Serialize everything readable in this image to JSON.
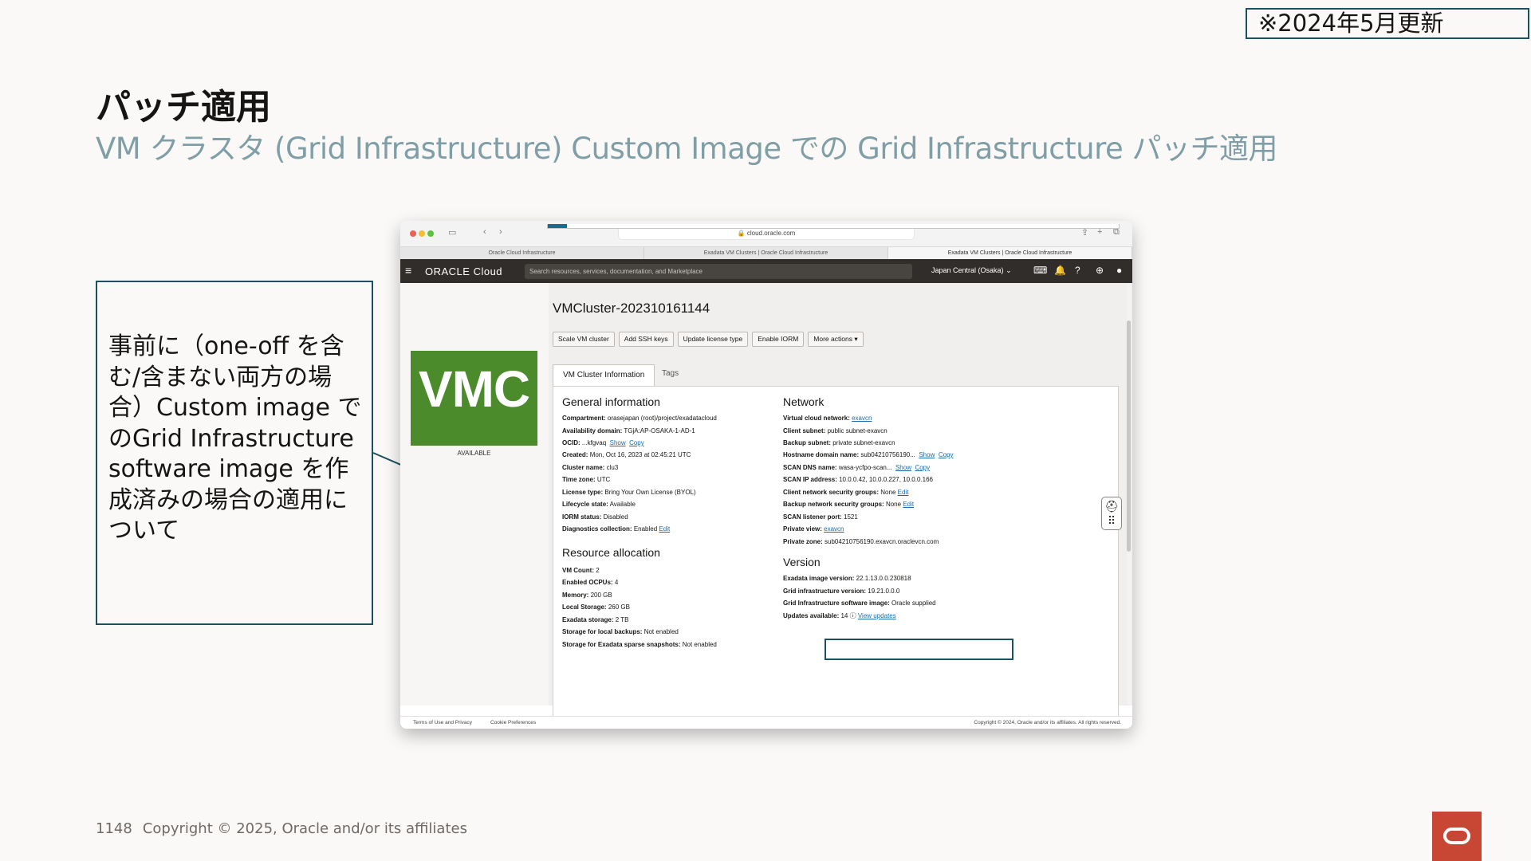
{
  "badge": "※2024年5月更新",
  "title": "パッチ適用",
  "subtitle": "VM クラスタ (Grid Infrastructure) Custom Image での Grid Infrastructure パッチ適用",
  "note": "事前に（one-off を含む/含まない両方の場合）Custom image でのGrid Infrastructure software image を作成済みの場合の適用について",
  "browser": {
    "url": "cloud.oracle.com",
    "tabs": [
      "Oracle Cloud Infrastructure",
      "Exadata VM Clusters | Oracle Cloud Infrastructure",
      "Exadata VM Clusters | Oracle Cloud Infrastructure"
    ]
  },
  "oci": {
    "logo": "ORACLE Cloud",
    "search_placeholder": "Search resources, services, documentation, and Marketplace",
    "region": "Japan Central (Osaka)"
  },
  "side": {
    "tile": "VMC",
    "status": "AVAILABLE"
  },
  "cluster": {
    "name": "VMCluster-202310161144",
    "actions": [
      "Scale VM cluster",
      "Add SSH keys",
      "Update license type",
      "Enable IORM",
      "More actions ▾"
    ],
    "tabs": {
      "info": "VM Cluster Information",
      "tags": "Tags"
    }
  },
  "general": {
    "title": "General information",
    "compartment": {
      "label": "Compartment:",
      "value": "orasejapan (root)/project/exadatacloud"
    },
    "ad": {
      "label": "Availability domain:",
      "value": "TGjA:AP-OSAKA-1-AD-1"
    },
    "ocid": {
      "label": "OCID:",
      "value": "...kfgvaq",
      "show": "Show",
      "copy": "Copy"
    },
    "created": {
      "label": "Created:",
      "value": "Mon, Oct 16, 2023 at 02:45:21 UTC"
    },
    "cluster_name": {
      "label": "Cluster name:",
      "value": "clu3"
    },
    "tz": {
      "label": "Time zone:",
      "value": "UTC"
    },
    "license": {
      "label": "License type:",
      "value": "Bring Your Own License (BYOL)"
    },
    "lifecycle": {
      "label": "Lifecycle state:",
      "value": "Available"
    },
    "iorm": {
      "label": "IORM status:",
      "value": "Disabled"
    },
    "diag": {
      "label": "Diagnostics collection:",
      "value": "Enabled",
      "edit": "Edit"
    }
  },
  "resources": {
    "title": "Resource allocation",
    "vm_count": {
      "label": "VM Count:",
      "value": "2"
    },
    "ocpus": {
      "label": "Enabled OCPUs:",
      "value": "4"
    },
    "memory": {
      "label": "Memory:",
      "value": "200 GB"
    },
    "local": {
      "label": "Local Storage:",
      "value": "260 GB"
    },
    "exa": {
      "label": "Exadata storage:",
      "value": "2 TB"
    },
    "backups": {
      "label": "Storage for local backups:",
      "value": "Not enabled"
    },
    "sparse": {
      "label": "Storage for Exadata sparse snapshots:",
      "value": "Not enabled"
    }
  },
  "network": {
    "title": "Network",
    "vcn": {
      "label": "Virtual cloud network:",
      "value": "exavcn"
    },
    "client": {
      "label": "Client subnet:",
      "value": "public subnet-exavcn"
    },
    "backup": {
      "label": "Backup subnet:",
      "value": "private subnet-exavcn"
    },
    "hostdomain": {
      "label": "Hostname domain name:",
      "value": "sub04210756190...",
      "show": "Show",
      "copy": "Copy"
    },
    "scandns": {
      "label": "SCAN DNS name:",
      "value": "wasa-ycfpo-scan...",
      "show": "Show",
      "copy": "Copy"
    },
    "scanip": {
      "label": "SCAN IP address:",
      "value": "10.0.0.42, 10.0.0.227, 10.0.0.166"
    },
    "clientnsg": {
      "label": "Client network security groups:",
      "value": "None",
      "edit": "Edit"
    },
    "backupnsg": {
      "label": "Backup network security groups:",
      "value": "None",
      "edit": "Edit"
    },
    "listener": {
      "label": "SCAN listener port:",
      "value": "1521"
    },
    "pview": {
      "label": "Private view:",
      "value": "exavcn"
    },
    "pzone": {
      "label": "Private zone:",
      "value": "sub04210756190.exavcn.oraclevcn.com"
    }
  },
  "version": {
    "title": "Version",
    "exa_image": {
      "label": "Exadata image version:",
      "value": "22.1.13.0.0.230818"
    },
    "gi_version": {
      "label": "Grid infrastructure version:",
      "value": "19.21.0.0.0"
    },
    "gi_image": {
      "label": "Grid Infrastructure software image:",
      "value": "Oracle supplied"
    },
    "updates": {
      "label": "Updates available:",
      "value": "14",
      "link": "View updates"
    }
  },
  "window_footer": {
    "terms": "Terms of Use and Privacy",
    "cookies": "Cookie Preferences",
    "copyright": "Copyright © 2024, Oracle and/or its affiliates. All rights reserved."
  },
  "footer": {
    "page": "1148",
    "copyright": "Copyright © 2025, Oracle and/or its affiliates"
  },
  "colors": {
    "accent": "#1c4f5f",
    "vmc_green": "#4c8b2c",
    "oracle_red": "#c74634",
    "subtitle": "#7f9ea6"
  }
}
